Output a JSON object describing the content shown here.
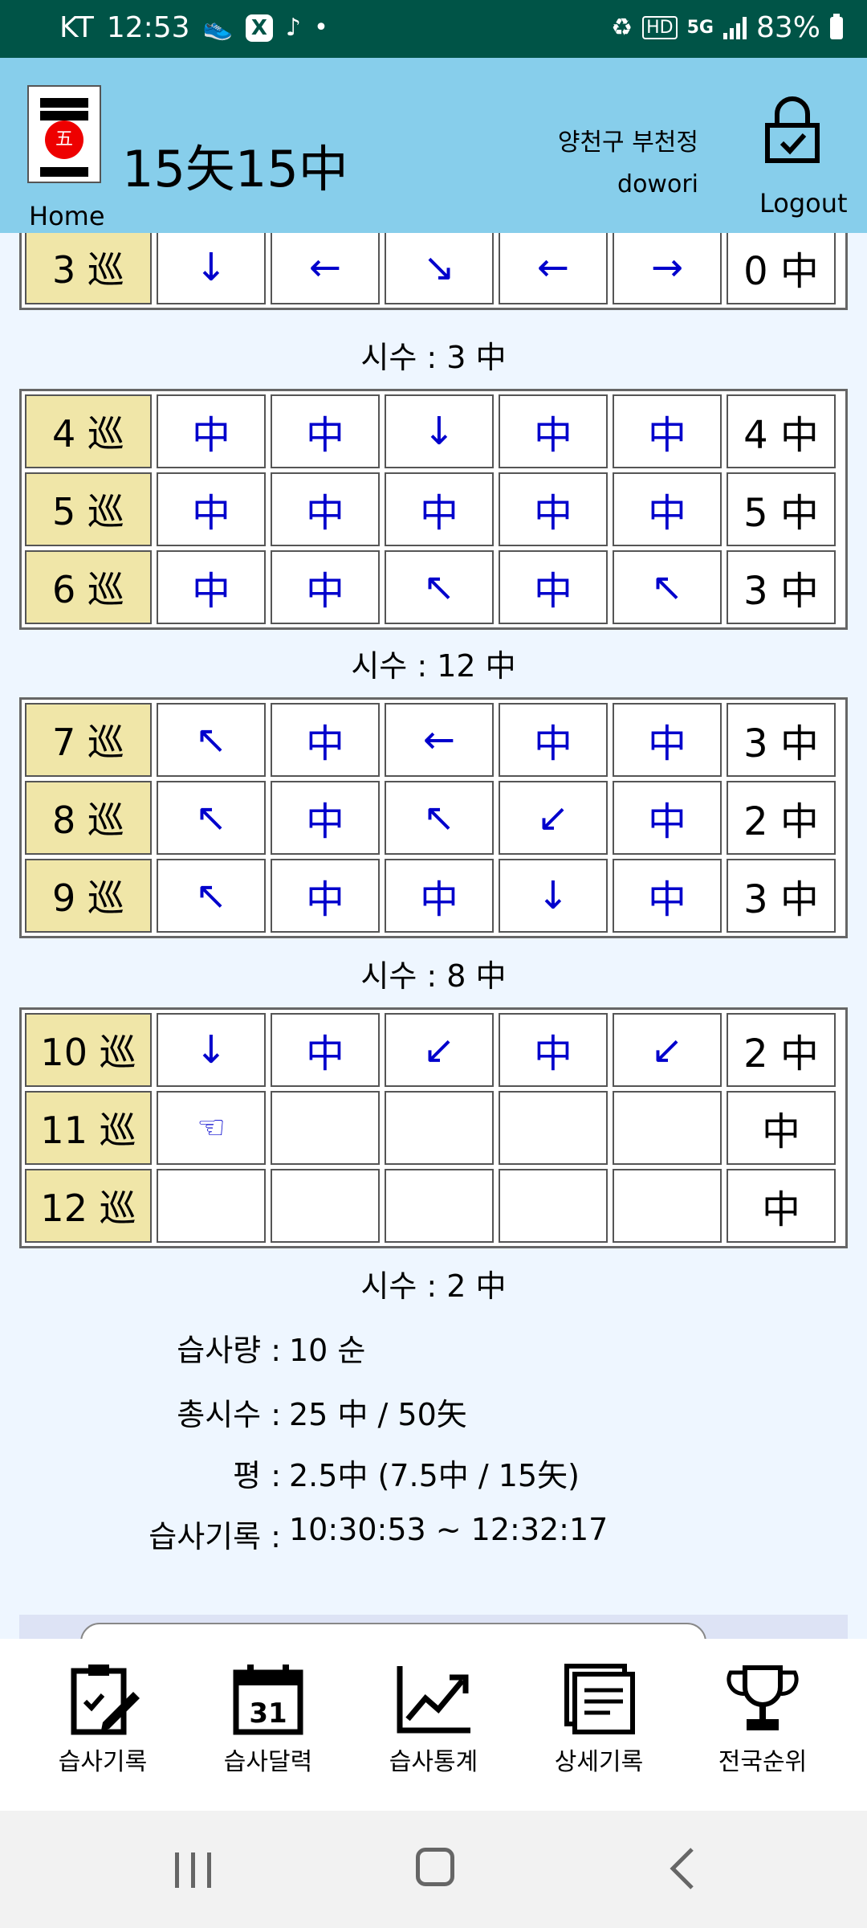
{
  "status_bar": {
    "carrier": "KT",
    "time": "12:53",
    "battery": "83%",
    "network": "5G",
    "hd": "HD"
  },
  "header": {
    "home_label": "Home",
    "title": "15矢15中",
    "user_location": "양천구 부천정",
    "user_id": "dowori",
    "logout_label": "Logout",
    "logo_char": "五"
  },
  "blocks": [
    {
      "rounds": [
        {
          "round": "3 巡",
          "shots": [
            "↓",
            "←",
            "↘",
            "←",
            "→"
          ],
          "score": "0 中"
        }
      ],
      "subtotal": "시수 : 3 中"
    },
    {
      "rounds": [
        {
          "round": "4 巡",
          "shots": [
            "中",
            "中",
            "↓",
            "中",
            "中"
          ],
          "score": "4 中"
        },
        {
          "round": "5 巡",
          "shots": [
            "中",
            "中",
            "中",
            "中",
            "中"
          ],
          "score": "5 中"
        },
        {
          "round": "6 巡",
          "shots": [
            "中",
            "中",
            "↖",
            "中",
            "↖"
          ],
          "score": "3 中"
        }
      ],
      "subtotal": "시수 : 12 中"
    },
    {
      "rounds": [
        {
          "round": "7 巡",
          "shots": [
            "↖",
            "中",
            "←",
            "中",
            "中"
          ],
          "score": "3 中"
        },
        {
          "round": "8 巡",
          "shots": [
            "↖",
            "中",
            "↖",
            "↙",
            "中"
          ],
          "score": "2 中"
        },
        {
          "round": "9 巡",
          "shots": [
            "↖",
            "中",
            "中",
            "↓",
            "中"
          ],
          "score": "3 中"
        }
      ],
      "subtotal": "시수 : 8 中"
    },
    {
      "rounds": [
        {
          "round": "10 巡",
          "shots": [
            "↓",
            "中",
            "↙",
            "中",
            "↙"
          ],
          "score": "2 中"
        },
        {
          "round": "11 巡",
          "shots": [
            "☜",
            "",
            "",
            "",
            ""
          ],
          "score": "中"
        },
        {
          "round": "12 巡",
          "shots": [
            "",
            "",
            "",
            "",
            ""
          ],
          "score": "中"
        }
      ],
      "subtotal": "시수 : 2 中"
    }
  ],
  "summary": {
    "practice_amount_label": "습사량 :",
    "practice_amount_value": "10 순",
    "total_label": "총시수 :",
    "total_value": "25 中 / 50矢",
    "average_label": "평 :",
    "average_value": "2.5中 (7.5中 / 15矢)",
    "record_label": "습사기록 :",
    "record_value": "10:30:53 ~ 12:32:17"
  },
  "bottom_nav": [
    {
      "label": "습사기록",
      "icon": "clipboard-edit-icon"
    },
    {
      "label": "습사달력",
      "icon": "calendar-icon",
      "calendar_day": "31"
    },
    {
      "label": "습사통계",
      "icon": "trend-chart-icon"
    },
    {
      "label": "상세기록",
      "icon": "documents-icon"
    },
    {
      "label": "전국순위",
      "icon": "trophy-icon"
    }
  ],
  "colors": {
    "status_bar": "#005447",
    "header": "#87ceeb",
    "round_cell": "#f0e6a8",
    "shot_text": "#0000cc",
    "page_bg": "#eef6ff"
  }
}
